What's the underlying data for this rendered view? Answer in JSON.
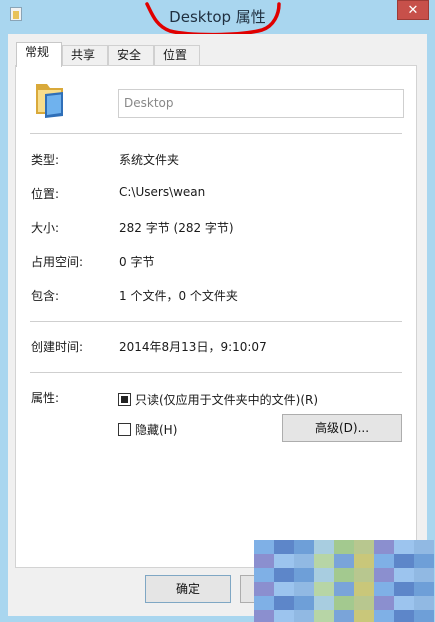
{
  "window": {
    "title": "Desktop 属性",
    "close_glyph": "✕"
  },
  "tabs": [
    {
      "label": "常规",
      "active": true
    },
    {
      "label": "共享",
      "active": false
    },
    {
      "label": "安全",
      "active": false
    },
    {
      "label": "位置",
      "active": false
    }
  ],
  "general": {
    "folder_name": "Desktop",
    "icon": "folder-icon",
    "rows": [
      {
        "label": "类型:",
        "value": "系统文件夹"
      },
      {
        "label": "位置:",
        "value": "C:\\Users\\wean"
      },
      {
        "label": "大小:",
        "value": "282 字节 (282 字节)"
      },
      {
        "label": "占用空间:",
        "value": "0 字节"
      },
      {
        "label": "包含:",
        "value": "1 个文件，0 个文件夹"
      }
    ],
    "created": {
      "label": "创建时间:",
      "value": "2014年8月13日，9:10:07"
    },
    "attributes": {
      "label": "属性:",
      "readonly": {
        "label": "只读(仅应用于文件夹中的文件)(R)",
        "checked": true
      },
      "hidden": {
        "label": "隐藏(H)",
        "checked": false
      },
      "advanced_label": "高级(D)..."
    }
  },
  "footer": {
    "ok_label": "确定",
    "cancel_label": ""
  },
  "colors": {
    "frame": "#a9d6ef",
    "annotation": "#e00000",
    "panel": "#ffffff"
  }
}
